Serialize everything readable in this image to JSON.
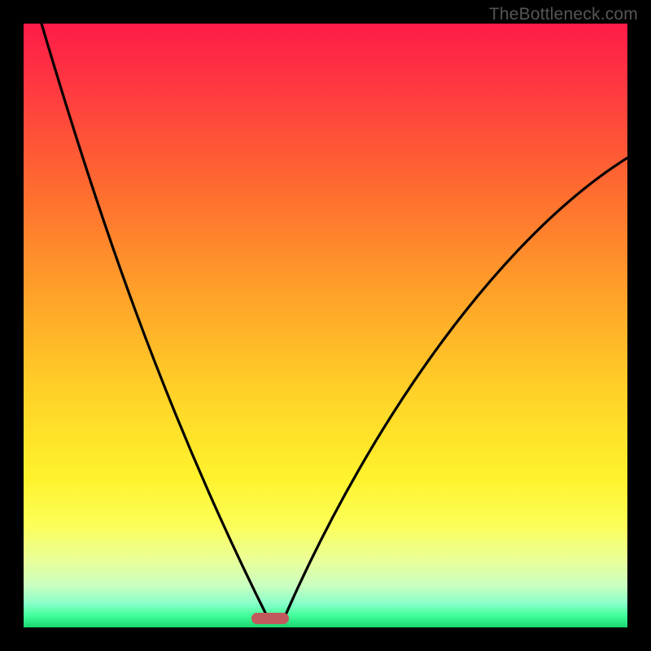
{
  "watermark": "TheBottleneck.com",
  "colors": {
    "background": "#000000",
    "marker": "#c15a5c",
    "curve_stroke": "#000000",
    "gradient_stops": [
      "#ff1b49",
      "#ff3d3f",
      "#ff6a30",
      "#ffa229",
      "#ffd428",
      "#fff22c",
      "#fcff57",
      "#e9ff9a",
      "#caffc0",
      "#8affc9",
      "#43ff9c",
      "#17d66f"
    ]
  },
  "chart_data": {
    "type": "line",
    "title": "",
    "xlabel": "",
    "ylabel": "",
    "xlim": [
      0,
      100
    ],
    "ylim": [
      0,
      100
    ],
    "note": "V-shaped bottleneck curve; minimum (optimal / zero-bottleneck point) marked with a pill near x≈41. Values are read off the plotted geometry as percentage of plot height.",
    "series": [
      {
        "name": "left-branch",
        "x": [
          3,
          8,
          13,
          18,
          23,
          28,
          33,
          38,
          41
        ],
        "values": [
          100,
          85,
          70,
          56,
          43,
          30,
          19,
          8,
          0
        ]
      },
      {
        "name": "right-branch",
        "x": [
          41,
          46,
          51,
          56,
          61,
          66,
          71,
          76,
          81,
          86,
          91,
          96,
          100
        ],
        "values": [
          0,
          8,
          17,
          25,
          33,
          41,
          48,
          55,
          61,
          66,
          71,
          75,
          78
        ]
      }
    ],
    "marker": {
      "x": 41,
      "y": 0
    }
  }
}
